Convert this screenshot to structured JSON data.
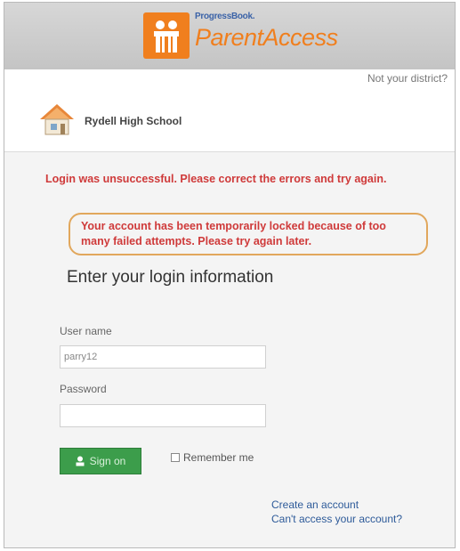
{
  "header": {
    "brand_small": "ProgressBook.",
    "brand_large": "ParentAccess",
    "logo_icon": "people-icon",
    "accent_color": "#f07f1e"
  },
  "district": {
    "not_district_link": "Not your district?",
    "school_name": "Rydell High School",
    "school_icon": "house-icon"
  },
  "errors": {
    "login_error": "Login was unsuccessful. Please correct the errors and try again.",
    "lock_message": "Your account has been temporarily locked because of too many failed attempts. Please try again later."
  },
  "form": {
    "heading": "Enter your login information",
    "username_label": "User name",
    "username_value": "parry12",
    "password_label": "Password",
    "password_value": "",
    "signin_label": "Sign on",
    "remember_label": "Remember me",
    "remember_checked": false
  },
  "links": {
    "create_account": "Create an account",
    "cant_access": "Can't access your account?"
  }
}
